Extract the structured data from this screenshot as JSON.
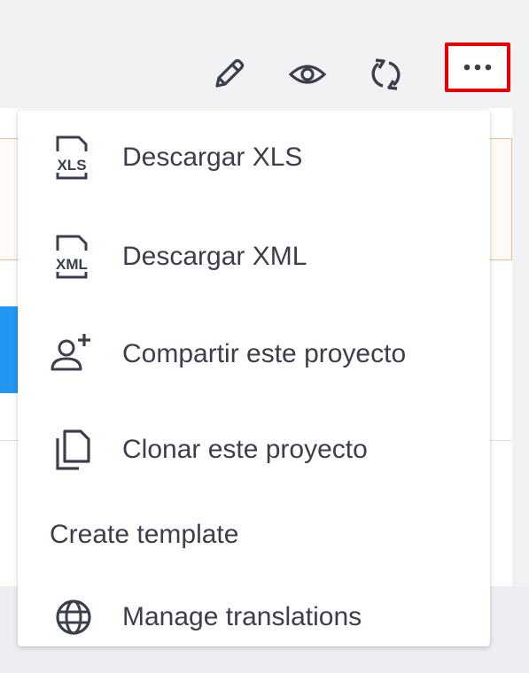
{
  "toolbar": {
    "icons": [
      "pencil-icon",
      "eye-icon",
      "sync-icon",
      "more-horizontal-icon"
    ]
  },
  "menu": {
    "items": [
      {
        "label": "Descargar XLS",
        "icon": "xls-file-icon"
      },
      {
        "label": "Descargar XML",
        "icon": "xml-file-icon"
      },
      {
        "label": "Compartir este proyecto",
        "icon": "add-user-icon"
      },
      {
        "label": "Clonar este proyecto",
        "icon": "copy-icon"
      },
      {
        "label": "Create template",
        "icon": ""
      },
      {
        "label": "Manage translations",
        "icon": "globe-icon"
      }
    ]
  },
  "colors": {
    "icon": "#3a3f4b",
    "highlight_border": "#e60000",
    "accent_blue": "#2196f3",
    "orange_border": "#f3b98a"
  }
}
